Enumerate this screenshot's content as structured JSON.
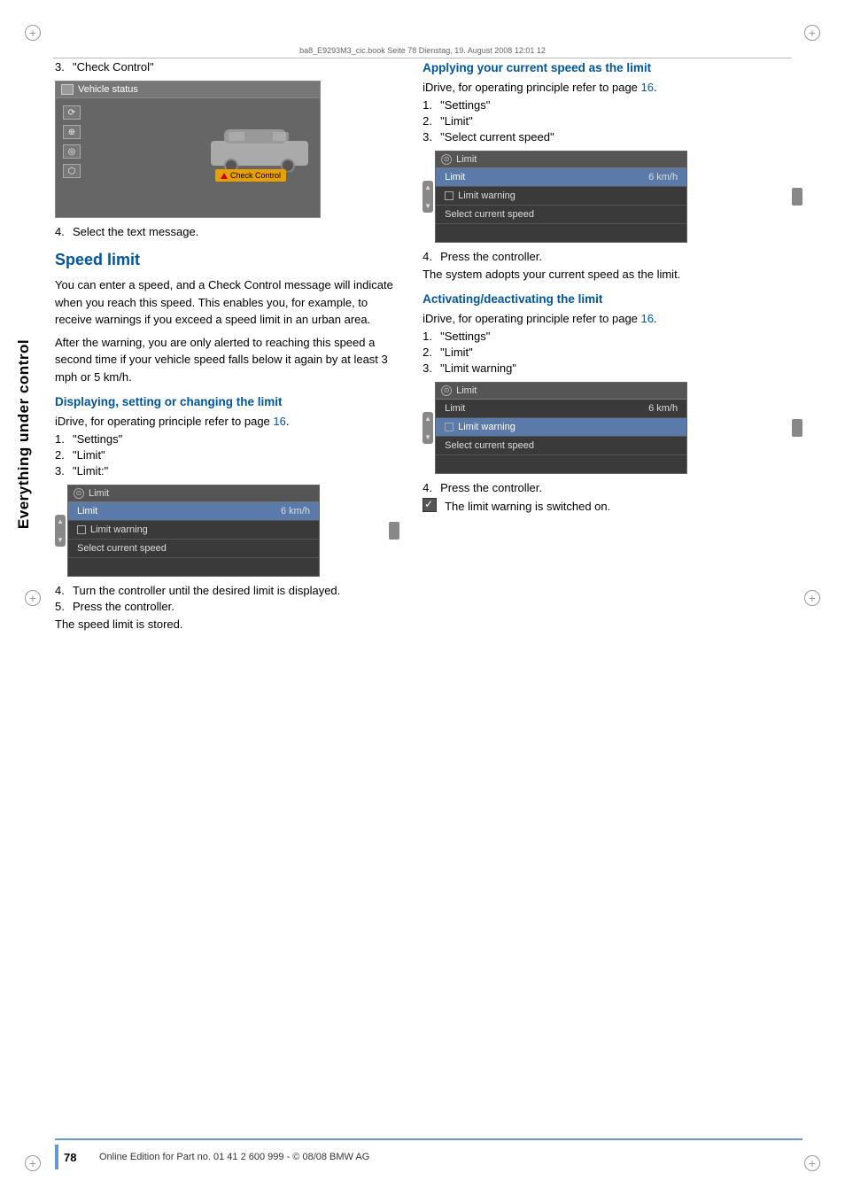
{
  "header": {
    "file_info": "ba8_E9293M3_cic.book  Seite 78  Dienstag, 19. August 2008  12:01 12"
  },
  "sidebar": {
    "label": "Everything under control"
  },
  "left_column": {
    "step3_label": "3.",
    "step3_text": "\"Check Control\"",
    "step4_label": "4.",
    "step4_text": "Select the text message.",
    "speed_limit_title": "Speed limit",
    "speed_limit_body1": "You can enter a speed, and a Check Control message will indicate when you reach this speed. This enables you, for example, to receive warnings if you exceed a speed limit in an urban area.",
    "speed_limit_body2": "After the warning, you are only alerted to reaching this speed a second time if your vehicle speed falls below it again by at least 3 mph or 5 km/h.",
    "display_heading": "Displaying, setting or changing the limit",
    "idrive_note1": "iDrive, for operating principle refer to page",
    "idrive_link1": "16",
    "step1_text": "\"Settings\"",
    "step2_text": "\"Limit\"",
    "step3b_text": "\"Limit:\"",
    "step4b_label": "4.",
    "step4b_text": "Turn the controller until the desired limit is displayed.",
    "step5_label": "5.",
    "step5_text": "Press the controller.",
    "result_text": "The speed limit is stored."
  },
  "right_column": {
    "applying_heading": "Applying your current speed as the limit",
    "idrive_note2": "iDrive, for operating principle refer to page",
    "idrive_link2": "16",
    "r_step1_text": "\"Settings\"",
    "r_step2_text": "\"Limit\"",
    "r_step3_text": "\"Select current speed\"",
    "r_step4_label": "4.",
    "r_step4_text": "Press the controller.",
    "result2_text": "The system adopts your current speed as the limit.",
    "activating_heading": "Activating/deactivating the limit",
    "idrive_note3": "iDrive, for operating principle refer to page",
    "idrive_link3": "16",
    "a_step1_text": "\"Settings\"",
    "a_step2_text": "\"Limit\"",
    "a_step3_text": "\"Limit warning\"",
    "a_step4_label": "4.",
    "a_step4_text": "Press the controller.",
    "a_result_note": "The limit warning is switched on."
  },
  "limit_screen1": {
    "title": "Limit",
    "row1_label": "Limit",
    "row1_speed": "6 km/h",
    "row2_label": "Limit warning",
    "row3_label": "Select current speed",
    "highlighted_row": 1
  },
  "limit_screen2": {
    "title": "Limit",
    "row1_label": "Limit",
    "row1_speed": "6 km/h",
    "row2_label": "Limit warning",
    "row3_label": "Select current speed",
    "highlighted_row": 1
  },
  "limit_screen3": {
    "title": "Limit",
    "row1_label": "Limit",
    "row1_speed": "6 km/h",
    "row2_label": "Limit warning",
    "row3_label": "Select current speed",
    "highlighted_row": 2
  },
  "vehicle_status_screen": {
    "title": "Vehicle status",
    "check_control_label": "Check Control"
  },
  "footer": {
    "page_number": "78",
    "footnote": "Online Edition for Part no. 01 41 2 600 999 - © 08/08 BMW AG"
  }
}
